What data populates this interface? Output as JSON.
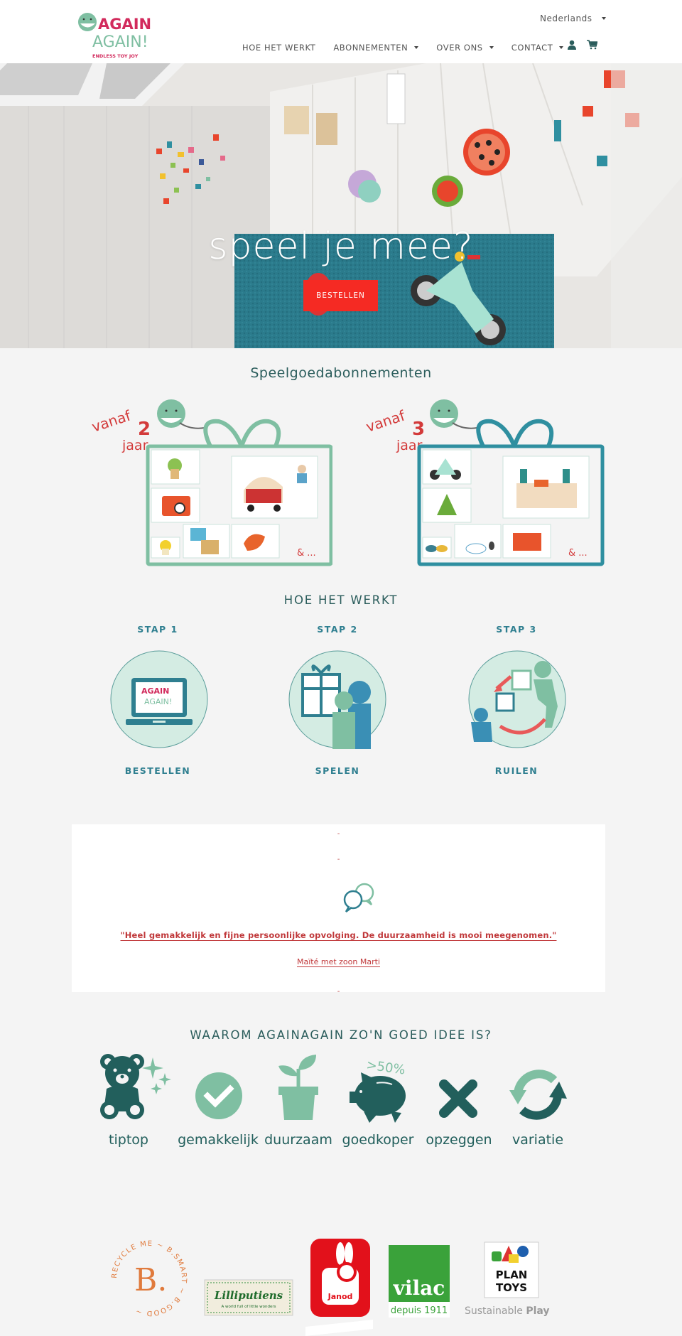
{
  "header": {
    "logo": {
      "line1": "AGAIN",
      "line2": "AGAIN!",
      "tagline": "ENDLESS TOY JOY"
    },
    "language": "Nederlands",
    "nav": [
      {
        "label": "HOE HET WERKT",
        "dropdown": false
      },
      {
        "label": "ABONNEMENTEN",
        "dropdown": true
      },
      {
        "label": "OVER ONS",
        "dropdown": true
      },
      {
        "label": "CONTACT",
        "dropdown": true
      }
    ],
    "icons": [
      "account-icon",
      "cart-icon"
    ]
  },
  "hero": {
    "title": "speel je mee?",
    "button": "BESTELLEN",
    "slides": 3,
    "active_slide": 1
  },
  "subscriptions": {
    "title": "Speelgoedabonnementen",
    "boxes": [
      {
        "prefix": "vanaf",
        "age": "2",
        "suffix": "jaar",
        "more": "& ...",
        "color": "#7fbfa2"
      },
      {
        "prefix": "vanaf",
        "age": "3",
        "suffix": "jaar",
        "more": "& ...",
        "color": "#2f8fa0"
      }
    ]
  },
  "how": {
    "title": "HOE HET WERKT",
    "steps": [
      {
        "label": "STAP 1",
        "action": "BESTELLEN"
      },
      {
        "label": "STAP 2",
        "action": "SPELEN"
      },
      {
        "label": "STAP 3",
        "action": "RUILEN"
      }
    ]
  },
  "testimonial": {
    "dash": "-",
    "quote": "\"Heel gemakkelijk en fijne persoonlijke opvolging. De duurzaamheid is mooi meegenomen.\"",
    "author": "Maïté met zoon Marti"
  },
  "why": {
    "title": "WAAROM AGAINAGAIN ZO'N GOED IDEE IS?",
    "badge": ">50%",
    "features": [
      {
        "label": "tiptop",
        "icon": "teddy-bear-icon"
      },
      {
        "label": "gemakkelijk",
        "icon": "check-circle-icon"
      },
      {
        "label": "duurzaam",
        "icon": "plant-pot-icon"
      },
      {
        "label": "goedkoper",
        "icon": "piggy-bank-icon"
      },
      {
        "label": "opzeggen",
        "icon": "cross-icon"
      },
      {
        "label": "variatie",
        "icon": "refresh-icon"
      }
    ]
  },
  "brands": {
    "btoys": {
      "letter": "B.",
      "ring": "RECYCLE ME ~ B.SMART ~ B.GOOD ~"
    },
    "lilliputiens": {
      "name": "Lilliputiens",
      "tagline": "A world full of little wonders"
    },
    "janod": {
      "name": "Janod"
    },
    "vilac": {
      "name": "vilac",
      "tagline": "depuis 1911"
    },
    "plantoys": {
      "line1": "PLAN",
      "line2": "TOYS",
      "tagline_light": "Sustainable",
      "tagline_bold": "Play"
    }
  },
  "colors": {
    "primary": "#2b5d5c",
    "accent_red": "#f52a23",
    "mint": "#7fbfa2",
    "teal": "#2f8fa0",
    "quote_red": "#c0383a"
  }
}
